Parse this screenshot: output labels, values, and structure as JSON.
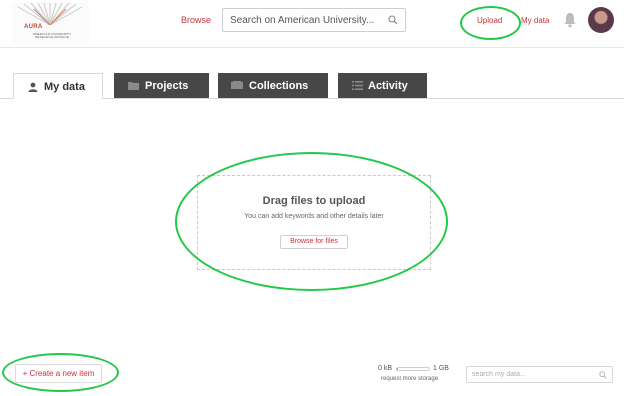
{
  "header": {
    "logo": {
      "name": "AURA",
      "subtitle": "AMERICAN UNIVERSITY RESEARCH ARCHIVE"
    },
    "nav": {
      "browse_label": "Browse",
      "upload_label": "Upload",
      "mydata_label": "My data"
    },
    "search": {
      "placeholder": "Search on American University..."
    },
    "icons": {
      "search": "search-icon",
      "notifications": "bell-icon",
      "avatar": "user-avatar"
    }
  },
  "tabs": [
    {
      "label": "My data",
      "icon": "user-icon",
      "active": true
    },
    {
      "label": "Projects",
      "icon": "folder-icon",
      "active": false
    },
    {
      "label": "Collections",
      "icon": "collection-icon",
      "active": false
    },
    {
      "label": "Activity",
      "icon": "list-icon",
      "active": false
    }
  ],
  "dropzone": {
    "title": "Drag files to upload",
    "subtitle": "You can add keywords and other details later",
    "browse_label": "Browse for files"
  },
  "footer": {
    "create_label": "+ Create a new item",
    "storage": {
      "used": "0 kB",
      "total": "1 GB",
      "used_fraction": 0.01,
      "request_label": "request more storage"
    },
    "search": {
      "placeholder": "search my data..."
    }
  },
  "colors": {
    "accent": "#c8333a",
    "tab_dark": "#474747",
    "annotation": "#22c84a",
    "storage_fill": "#3a9fd6"
  }
}
